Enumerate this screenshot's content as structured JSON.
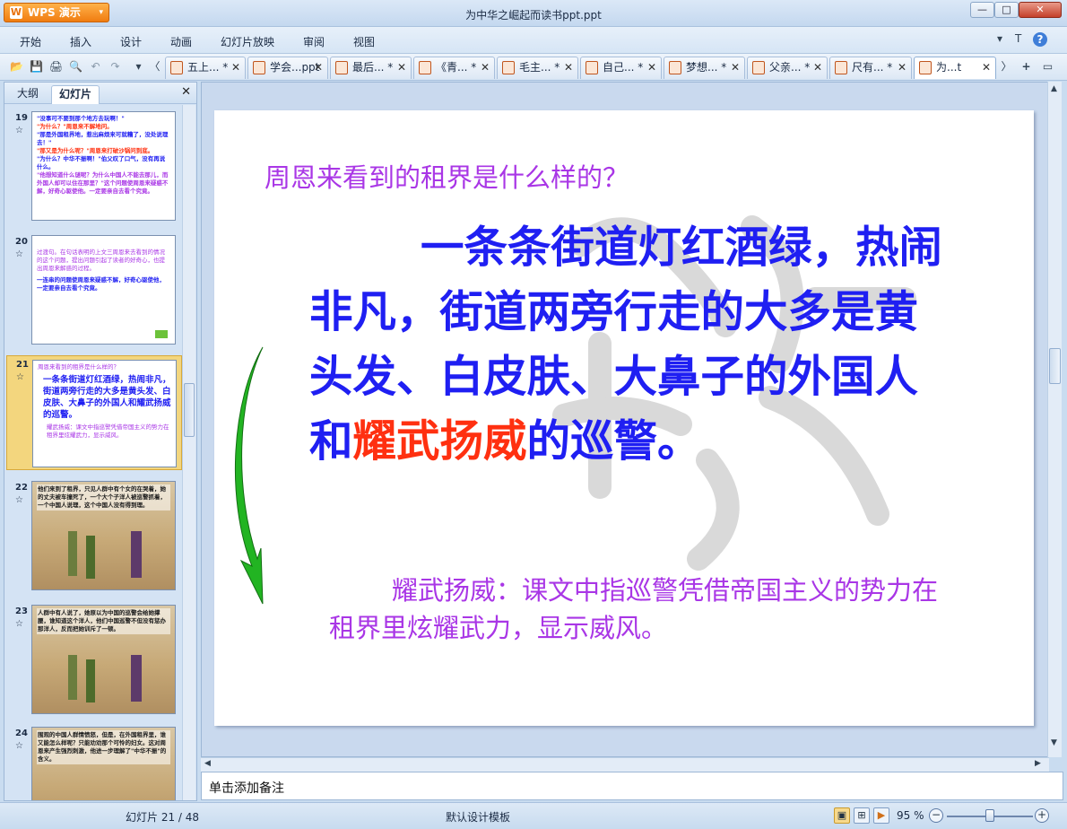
{
  "app": {
    "button_label": "WPS 演示",
    "window_title": "为中华之崛起而读书ppt.ppt"
  },
  "window_buttons": {
    "minimize": "—",
    "maximize": "□",
    "close": "✕"
  },
  "menu": {
    "items": [
      "开始",
      "插入",
      "设计",
      "动画",
      "幻灯片放映",
      "审阅",
      "视图"
    ],
    "right_icons": [
      "▾",
      "T",
      "?"
    ]
  },
  "toolbar": {
    "icons": [
      "📂",
      "💾",
      "🖨",
      "🔍",
      "↶",
      "↷",
      "▾",
      "〈"
    ],
    "right_icons": [
      "〉",
      "+",
      "▭"
    ]
  },
  "tabs": [
    {
      "label": "五上...",
      "mod": "*"
    },
    {
      "label": "学会...ppt",
      "mod": ""
    },
    {
      "label": "最后...",
      "mod": "*"
    },
    {
      "label": "《青...",
      "mod": "*"
    },
    {
      "label": "毛主...",
      "mod": "*"
    },
    {
      "label": "自己...",
      "mod": "*"
    },
    {
      "label": "梦想...",
      "mod": "*"
    },
    {
      "label": "父亲...",
      "mod": "*"
    },
    {
      "label": "尺有...",
      "mod": "*"
    },
    {
      "label": "为...t",
      "mod": "",
      "active": true
    }
  ],
  "left_panel": {
    "tab_outline": "大纲",
    "tab_slides": "幻灯片",
    "close": "✕",
    "star": "☆",
    "thumbs": [
      {
        "num": "19",
        "lines": [
          "\"没事可不要到那个地方去玩啊！\"",
          "\"为什么？\"周恩来不解地问。",
          "\"那是外国租界地，惹出麻烦来可就糟了，没处说理去！\"",
          "\"那又是为什么呢？\"周恩来打破沙锅问到底。",
          "\"为什么？中华不振啊！\"伯父叹了口气，没有再说什么。",
          "\"他想知道什么谜呢？为什么中国人不能去那儿，而外国人却可以住在那里？\"这个问题使周恩来疑惑不解，好奇心驱使他。一定要亲自去看个究竟。"
        ]
      },
      {
        "num": "20",
        "lines": [
          "过渡句。在句话表明的上文三周恩来去看到的情况的这个问题，提出问题引起了读者的好奇心，也提出周恩来解惑的过程。",
          "一连串的问题使周恩来疑惑不解，好奇心驱使他，一定要亲自去看个究竟。"
        ]
      },
      {
        "num": "21",
        "lines": [
          "周恩来看到的租界是什么样的？",
          "一条条街道灯红酒绿，热闹非凡，街道两旁行走的大多是黄头发、白皮肤、大鼻子的外国人和耀武扬威的巡警。",
          "耀武扬威：课文中指巡警凭借帝国主义的势力在租界里炫耀武力，显示威风。"
        ]
      },
      {
        "num": "22",
        "lines": [
          "他们来到了租界，只见人群中有个女的在哭着，她的丈夫被车撞死了，一个大个子洋人被巡警抓着，一个中国人说理，这个中国人没有得到理。"
        ]
      },
      {
        "num": "23",
        "lines": [
          "人群中有人说了，她原以为中国的巡警会给她撑腰，谁知道这个洋人，他们中国巡警不但没有惩办那洋人，反而把她训斥了一顿。"
        ]
      },
      {
        "num": "24",
        "lines": [
          "围观的中国人群情愤怒，但是，在外国租界里，谁又能怎么样呢？只能劝劝那个可怜的妇女。这对周恩来产生强烈刺激，他进一步理解了\"中华不振\"的含义。"
        ]
      }
    ]
  },
  "slide": {
    "question": "周恩来看到的租界是什么样的？",
    "main_a": "一条条街道灯红酒绿，热闹非凡，街道两旁行走的大多是黄头发、白皮肤、大鼻子的外国人和",
    "main_highlight": "耀武扬威",
    "main_b": "的巡警。",
    "note": "耀武扬威：课文中指巡警凭借帝国主义的势力在租界里炫耀武力，显示威风。",
    "colors": {
      "main": "#1f1ff2",
      "highlight": "#ff3010",
      "purple": "#a936e6",
      "arrow": "#22b422"
    }
  },
  "notes": {
    "placeholder": "单击添加备注"
  },
  "status": {
    "slide_info": "幻灯片 21 / 48",
    "template": "默认设计模板",
    "zoom": "95 %",
    "zoom_level": 0.5,
    "zoom_minus": "−",
    "zoom_plus": "+"
  }
}
